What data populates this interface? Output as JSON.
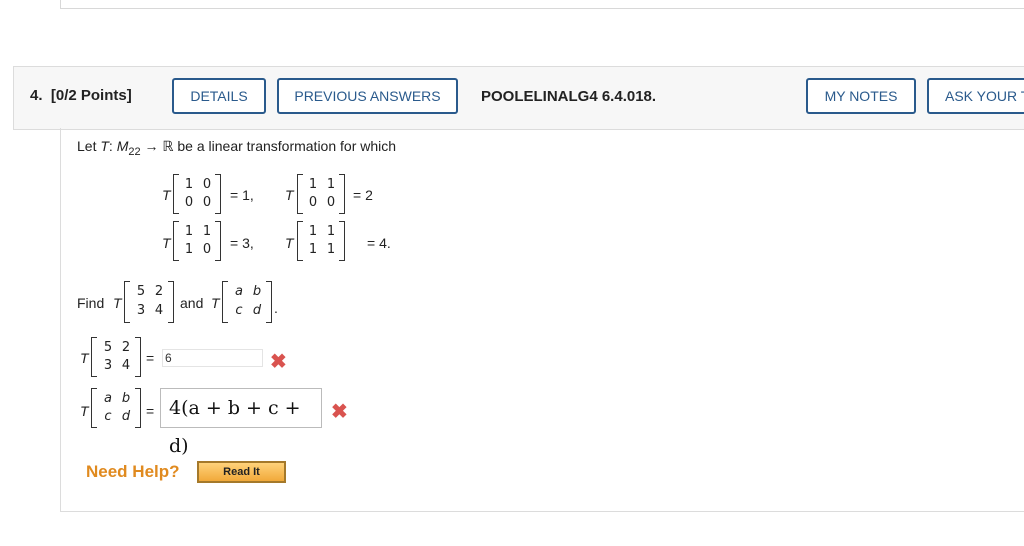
{
  "question": {
    "number_label": "4.",
    "points_label": "[0/2 Points]",
    "reference": "POOLELINALG4 6.4.018."
  },
  "buttons": {
    "details": "DETAILS",
    "previous_answers": "PREVIOUS ANSWERS",
    "my_notes": "MY NOTES",
    "ask_your": "ASK YOUR T"
  },
  "problem": {
    "intro_let": "Let",
    "intro_T": "T",
    "intro_colon": ":",
    "intro_M": "M",
    "intro_sub": "22",
    "intro_rest": "→ ℝ be a linear transformation for which",
    "T": "T",
    "given": [
      {
        "matrix": [
          "1",
          "0",
          "0",
          "0"
        ],
        "result": "= 1,"
      },
      {
        "matrix": [
          "1",
          "1",
          "0",
          "0"
        ],
        "result": "= 2"
      },
      {
        "matrix": [
          "1",
          "1",
          "1",
          "0"
        ],
        "result": "= 3,"
      },
      {
        "matrix": [
          "1",
          "1",
          "1",
          "1"
        ],
        "result": "= 4."
      }
    ],
    "find_label": "Find",
    "find_matrix": [
      "5",
      "2",
      "3",
      "4"
    ],
    "and_label": "and",
    "var_matrix": [
      "a",
      "b",
      "c",
      "d"
    ],
    "period": "."
  },
  "answers": {
    "equals": "=",
    "answer1": "6",
    "answer2": "4(a + b + c + d)",
    "wrong_icon": "✖"
  },
  "help": {
    "need_help": "Need Help?",
    "read_it": "Read It"
  }
}
